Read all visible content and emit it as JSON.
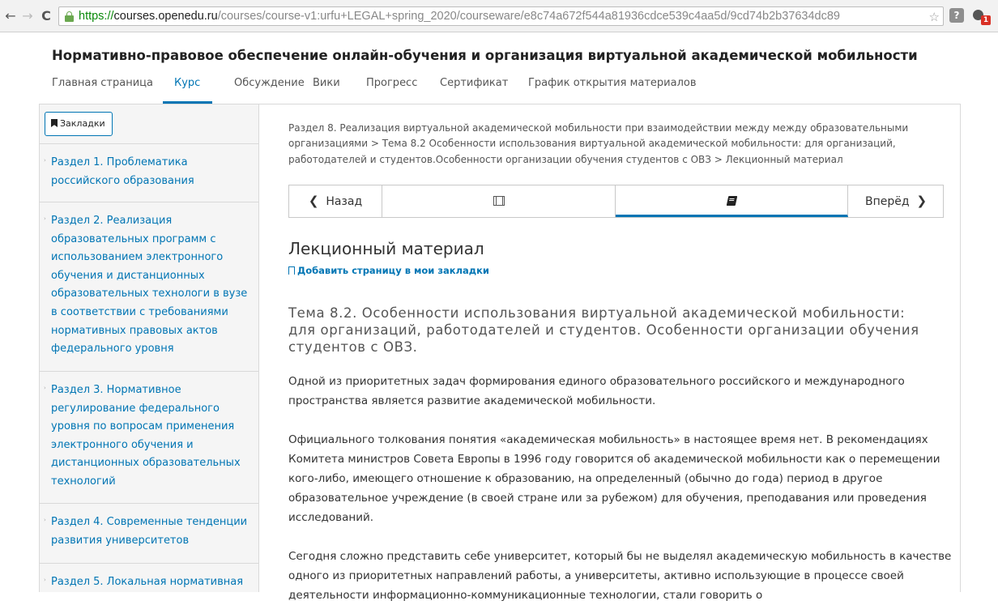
{
  "browser": {
    "back_glyph": "←",
    "forward_glyph": "→",
    "reload_glyph": "C",
    "url_https": "https://",
    "url_host": "courses.openedu.ru",
    "url_path": "/courses/course-v1:urfu+LEGAL+spring_2020/courseware/e8c74a672f544a81936cdce539c4aa5d/9cd74b2b37634dc89",
    "star_glyph": "☆",
    "help_glyph": "?",
    "user_badge": "1"
  },
  "course": {
    "title": "Нормативно-правовое обеспечение онлайн-обучения и организация виртуальной академической мобильности",
    "tabs": [
      {
        "label": "Главная страница"
      },
      {
        "label": "Курс"
      },
      {
        "label": "Обсуждение"
      },
      {
        "label": "Вики"
      },
      {
        "label": "Прогресс"
      },
      {
        "label": "Сертификат"
      },
      {
        "label": "График открытия материалов"
      }
    ]
  },
  "sidebar": {
    "bookmarks_label": "Закладки",
    "caret_glyph": "›",
    "sections": [
      {
        "label": "Раздел 1. Проблематика российского образования"
      },
      {
        "label": "Раздел 2. Реализация образовательных программ с использованием электронного обучения и дистанционных образовательных технологи в вузе в соответствии с требованиями нормативных правовых актов федерального уровня"
      },
      {
        "label": "Раздел 3. Нормативное регулирование федерального уровня по вопросам применения электронного обучения и дистанционных образовательных технологий"
      },
      {
        "label": "Раздел 4. Современные тенденции развития университетов"
      },
      {
        "label": "Раздел 5. Локальная нормативная"
      }
    ]
  },
  "main": {
    "breadcrumb": "Раздел 8. Реализация виртуальной академической мобильности при взаимодействии между между образовательными организациями > Тема 8.2 Особенности использования виртуальной академической мобильности: для организаций, работодателей и студентов.Особенности организации обучения студентов с ОВЗ > Лекционный материал",
    "nav": {
      "prev_label": "Назад",
      "prev_glyph": "❮",
      "next_label": "Вперёд",
      "next_glyph": "❯"
    },
    "lecture_title": "Лекционный материал",
    "add_bookmark": "Добавить страницу в мои закладки",
    "topic_heading": "Тема 8.2. Особенности использования виртуальной академической мобильности: для организаций, работодателей и студентов. Особенности организации обучения студентов с ОВЗ.",
    "paragraphs": [
      "Одной из приоритетных задач формирования единого образовательного российского и международного пространства является развитие академической мобильности.",
      "Официального толкования понятия «академическая мобильность» в настоящее время нет. В рекомендациях Комитета министров Совета Европы в 1996 году говорится об академической мобильности как о перемещении кого-либо, имеющего отношение к образованию, на определенный (обычно до года) период в другое образовательное учреждение (в своей стране или за рубежом) для обучения, преподавания или проведения исследований.",
      "Сегодня сложно представить себе университет, который бы не выделял академическую мобильность в качестве одного из приоритетных направлений работы, а университеты, активно использующие в процессе своей деятельности информационно-коммуникационные технологии, стали говорить о"
    ]
  },
  "colors": {
    "link": "#0075b4",
    "text": "#333333",
    "sidebar_bg": "#f5f5f5",
    "border": "#d9d9d9",
    "ssl_green": "#0a8a0a"
  }
}
